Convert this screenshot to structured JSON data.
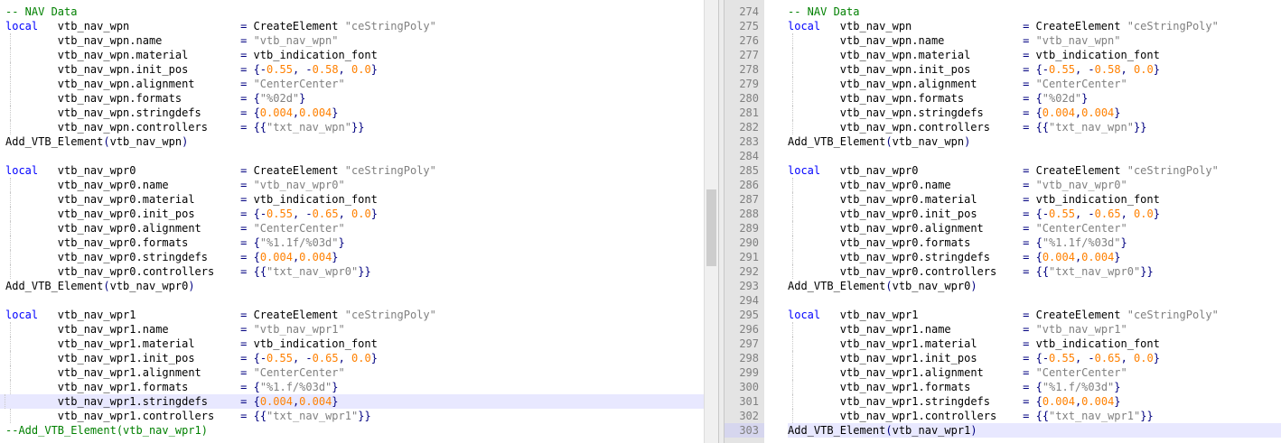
{
  "colors": {
    "keyword": "#0000ff",
    "comment": "#008000",
    "string": "#808080",
    "number": "#ff8000",
    "operator": "#000080",
    "line_highlight": "#e8e8ff",
    "gutter_bg": "#e4e4e4"
  },
  "left_editor": {
    "lines": [
      "-- NAV Data",
      "local   vtb_nav_wpn                 = CreateElement \"ceStringPoly\"",
      "        vtb_nav_wpn.name            = \"vtb_nav_wpn\"",
      "        vtb_nav_wpn.material        = vtb_indication_font",
      "        vtb_nav_wpn.init_pos        = {-0.55, -0.58, 0.0}",
      "        vtb_nav_wpn.alignment       = \"CenterCenter\"",
      "        vtb_nav_wpn.formats         = {\"%02d\"}",
      "        vtb_nav_wpn.stringdefs      = {0.004,0.004}",
      "        vtb_nav_wpn.controllers     = {{\"txt_nav_wpn\"}}",
      "Add_VTB_Element(vtb_nav_wpn)",
      "",
      "local   vtb_nav_wpr0                = CreateElement \"ceStringPoly\"",
      "        vtb_nav_wpr0.name           = \"vtb_nav_wpr0\"",
      "        vtb_nav_wpr0.material       = vtb_indication_font",
      "        vtb_nav_wpr0.init_pos       = {-0.55, -0.65, 0.0}",
      "        vtb_nav_wpr0.alignment      = \"CenterCenter\"",
      "        vtb_nav_wpr0.formats        = {\"%1.1f/%03d\"}",
      "        vtb_nav_wpr0.stringdefs     = {0.004,0.004}",
      "        vtb_nav_wpr0.controllers    = {{\"txt_nav_wpr0\"}}",
      "Add_VTB_Element(vtb_nav_wpr0)",
      "",
      "local   vtb_nav_wpr1                = CreateElement \"ceStringPoly\"",
      "        vtb_nav_wpr1.name           = \"vtb_nav_wpr1\"",
      "        vtb_nav_wpr1.material       = vtb_indication_font",
      "        vtb_nav_wpr1.init_pos       = {-0.55, -0.65, 0.0}",
      "        vtb_nav_wpr1.alignment      = \"CenterCenter\"",
      "        vtb_nav_wpr1.formats        = {\"%1.f/%03d\"}",
      "        vtb_nav_wpr1.stringdefs     = {0.004,0.004}",
      "        vtb_nav_wpr1.controllers    = {{\"txt_nav_wpr1\"}}",
      "--Add_VTB_Element(vtb_nav_wpr1)"
    ],
    "highlighted_line_index": 27
  },
  "right_editor": {
    "line_numbers": [
      "274",
      "275",
      "276",
      "277",
      "278",
      "279",
      "280",
      "281",
      "282",
      "283",
      "284",
      "285",
      "286",
      "287",
      "288",
      "289",
      "290",
      "291",
      "292",
      "293",
      "294",
      "295",
      "296",
      "297",
      "298",
      "299",
      "300",
      "301",
      "302",
      "303"
    ],
    "lines": [
      "-- NAV Data",
      "local   vtb_nav_wpn                 = CreateElement \"ceStringPoly\"",
      "        vtb_nav_wpn.name            = \"vtb_nav_wpn\"",
      "        vtb_nav_wpn.material        = vtb_indication_font",
      "        vtb_nav_wpn.init_pos        = {-0.55, -0.58, 0.0}",
      "        vtb_nav_wpn.alignment       = \"CenterCenter\"",
      "        vtb_nav_wpn.formats         = {\"%02d\"}",
      "        vtb_nav_wpn.stringdefs      = {0.004,0.004}",
      "        vtb_nav_wpn.controllers     = {{\"txt_nav_wpn\"}}",
      "Add_VTB_Element(vtb_nav_wpn)",
      "",
      "local   vtb_nav_wpr0                = CreateElement \"ceStringPoly\"",
      "        vtb_nav_wpr0.name           = \"vtb_nav_wpr0\"",
      "        vtb_nav_wpr0.material       = vtb_indication_font",
      "        vtb_nav_wpr0.init_pos       = {-0.55, -0.65, 0.0}",
      "        vtb_nav_wpr0.alignment      = \"CenterCenter\"",
      "        vtb_nav_wpr0.formats        = {\"%1.1f/%03d\"}",
      "        vtb_nav_wpr0.stringdefs     = {0.004,0.004}",
      "        vtb_nav_wpr0.controllers    = {{\"txt_nav_wpr0\"}}",
      "Add_VTB_Element(vtb_nav_wpr0)",
      "",
      "local   vtb_nav_wpr1                = CreateElement \"ceStringPoly\"",
      "        vtb_nav_wpr1.name           = \"vtb_nav_wpr1\"",
      "        vtb_nav_wpr1.material       = vtb_indication_font",
      "        vtb_nav_wpr1.init_pos       = {-0.55, -0.65, 0.0}",
      "        vtb_nav_wpr1.alignment      = \"CenterCenter\"",
      "        vtb_nav_wpr1.formats        = {\"%1.f/%03d\"}",
      "        vtb_nav_wpr1.stringdefs     = {0.004,0.004}",
      "        vtb_nav_wpr1.controllers    = {{\"txt_nav_wpr1\"}}",
      "Add_VTB_Element(vtb_nav_wpr1)"
    ],
    "highlighted_line_index": 29
  }
}
